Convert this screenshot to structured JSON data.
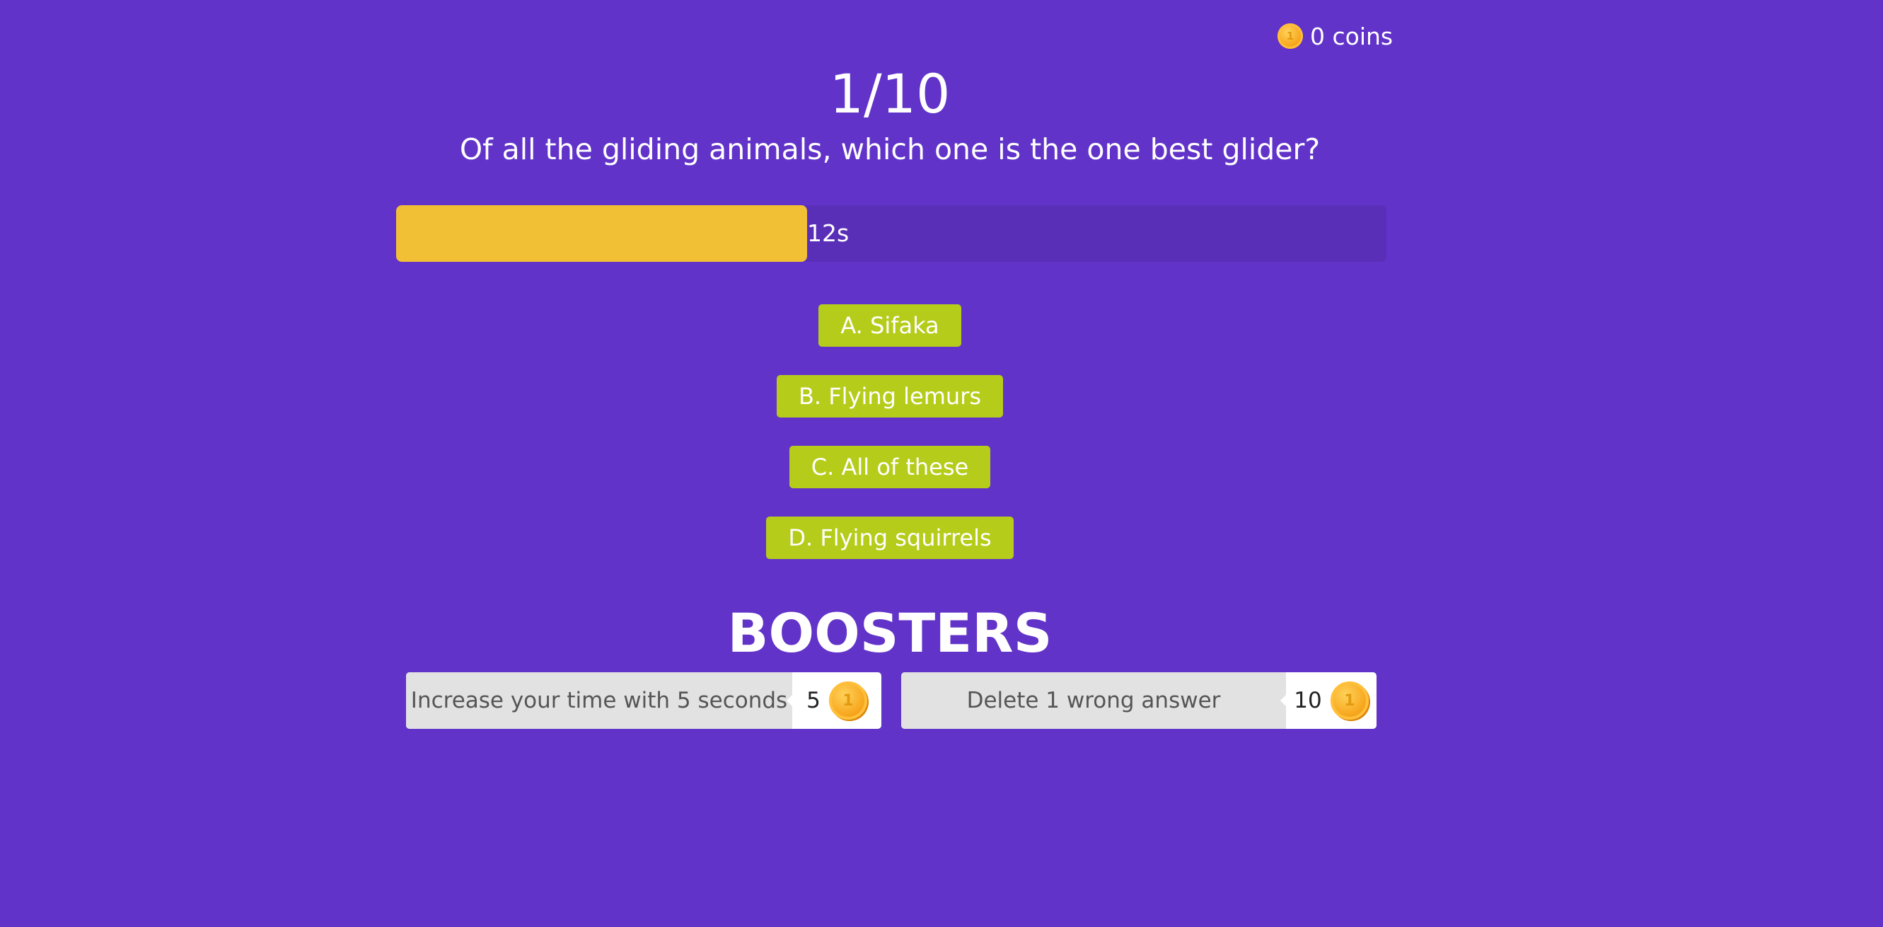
{
  "header": {
    "coins_label": "0 coins",
    "coin_glyph": "1",
    "coin_icon": "coin-icon"
  },
  "quiz": {
    "counter": "1/10",
    "question": "Of all the gliding animals, which one is the one best glider?"
  },
  "timer": {
    "label": "12s",
    "remaining_fraction": 0.415,
    "fill_color": "#f2c035",
    "track_color": "#5a2fb8"
  },
  "answers": [
    {
      "label": "A. Sifaka"
    },
    {
      "label": "B. Flying lemurs"
    },
    {
      "label": "C. All of these"
    },
    {
      "label": "D. Flying squirrels"
    }
  ],
  "boosters": {
    "title": "BOOSTERS",
    "items": [
      {
        "label": "Increase your time with 5 seconds",
        "price": "5",
        "coin_glyph": "1"
      },
      {
        "label": "Delete 1 wrong answer",
        "price": "10",
        "coin_glyph": "1"
      }
    ]
  },
  "colors": {
    "background": "#6233c9",
    "answer_button": "#b5cc1b",
    "booster_label_bg": "#e2e2e2"
  }
}
